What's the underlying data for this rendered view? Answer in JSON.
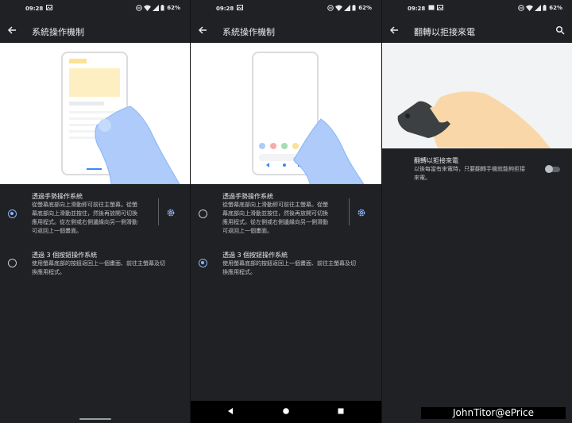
{
  "colors": {
    "background": "#202124",
    "accent": "#8ab4f8",
    "illustration_blue": "#aecbfa",
    "skin": "#f9d7a8",
    "text": "#e8eaed"
  },
  "panels": [
    {
      "status": {
        "time": "09:28",
        "battery": "62%",
        "icons": [
          "photo-icon",
          "dnd-icon",
          "wifi-icon",
          "signal-icon",
          "battery-icon"
        ]
      },
      "toolbar": {
        "title": "系統操作機制"
      },
      "options": [
        {
          "title": "透過手勢操作系統",
          "desc": [
            "從螢幕底部向上滑動即可前往主螢幕。從螢",
            "幕底部向上滑動並按住，然後再放開可切換",
            "應用程式。從左側或右側邊緣向另一側滑動",
            "可返回上一個畫面。"
          ],
          "selected": true
        },
        {
          "title": "透過 3 個按鈕操作系統",
          "desc": [
            "使用螢幕底部的按鈕返回上一個畫面、前往主螢幕及切",
            "換應用程式。"
          ],
          "selected": false
        }
      ]
    },
    {
      "status": {
        "time": "09:28",
        "battery": "62%"
      },
      "toolbar": {
        "title": "系統操作機制"
      },
      "options": [
        {
          "title": "透過手勢操作系統",
          "desc": [
            "從螢幕底部向上滑動即可前往主螢幕。從螢",
            "幕底部向上滑動並按住，然後再放開可切換",
            "應用程式。從左側或右側邊緣向另一側滑動",
            "可返回上一個畫面。"
          ],
          "selected": false
        },
        {
          "title": "透過 3 個按鈕操作系統",
          "desc": [
            "使用螢幕底部的按鈕返回上一個畫面、前往主螢幕及切",
            "換應用程式。"
          ],
          "selected": true
        }
      ]
    },
    {
      "status": {
        "time": "09:28",
        "battery": "62%"
      },
      "toolbar": {
        "title": "翻轉以拒接來電"
      },
      "setting": {
        "title": "翻轉以拒接來電",
        "desc": [
          "以後每當有來電時，只要翻轉手機就能夠拒接",
          "來電。"
        ],
        "enabled": false
      }
    }
  ],
  "watermark": "JohnTitor@ePrice"
}
